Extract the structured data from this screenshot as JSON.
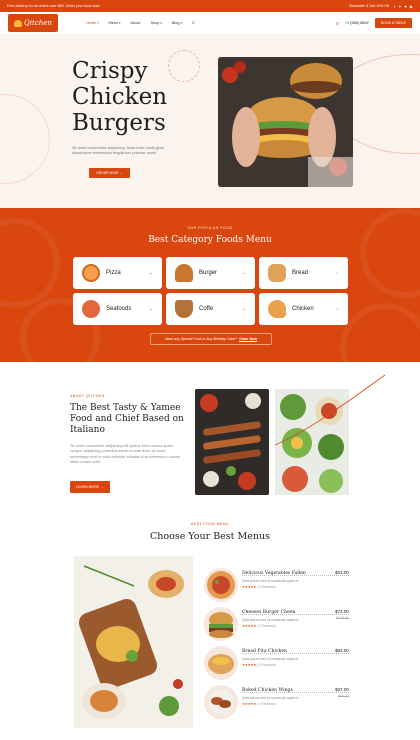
{
  "topbar": {
    "announcement": "Free delivery for all orders over $50. Order your food now!",
    "subscribe": "Subscribe & Get 10% Off",
    "social": [
      "f",
      "✦",
      "♥",
      "▶"
    ]
  },
  "header": {
    "logo_text": "Qitchen",
    "nav": [
      {
        "label": "Home",
        "active": true,
        "dropdown": true
      },
      {
        "label": "Menu",
        "active": false,
        "dropdown": true
      },
      {
        "label": "About",
        "active": false,
        "dropdown": false
      },
      {
        "label": "Shop",
        "active": false,
        "dropdown": true
      },
      {
        "label": "Blog",
        "active": false,
        "dropdown": true
      }
    ],
    "phone": "+1 (555) 5892",
    "book_label": "BOOK A TABLE"
  },
  "hero": {
    "title_lines": [
      "Crispy",
      "Chicken",
      "Burgers"
    ],
    "subtitle": "Sit amet consectetur adipiscing. Nulla iusto morbi gravi ullamcorper elementum feugiat nec pulvinar morbi",
    "button": "ORDER NOW →"
  },
  "categories": {
    "eyebrow": "OUR POPULAR FOOD",
    "heading": "Best Category Foods Menu",
    "items": [
      {
        "label": "Pizza",
        "icon": "pizza-icon",
        "color": "#f3a04a"
      },
      {
        "label": "Burger",
        "icon": "burger-icon",
        "color": "#c9772f"
      },
      {
        "label": "Bread",
        "icon": "bread-icon",
        "color": "#e0a35a"
      },
      {
        "label": "Seafoods",
        "icon": "octopus-icon",
        "color": "#e2673d"
      },
      {
        "label": "Coffe",
        "icon": "coffee-icon",
        "color": "#b5713a"
      },
      {
        "label": "Chicken",
        "icon": "chicken-icon",
        "color": "#e9a24a"
      }
    ],
    "note_text": "Need any Special Food or Any Birthday Cake? ",
    "note_link": "Order Now"
  },
  "about": {
    "eyebrow": "ABOUT QITCHEN",
    "title": "The Best Tasty & Yamee Food and Chief Based on Italiano",
    "text": "Sit amet consectetur adipiscing elit quisue Nam mauris quam congue adipiscing phasellus semin in ante dolor sit amet scelerisque erat in nulla molestie volutpat id at elementum mauris, etiam ornare dolor",
    "button": "LEARN MORE →"
  },
  "menus": {
    "eyebrow": "BEST FOOD MENU",
    "title": "Choose Your Best Menus",
    "items": [
      {
        "name": "Delicious Vegetables Fallen",
        "price": "$23.00",
        "old": "",
        "desc": "Quis ipsum sed et consecat coyat et",
        "reviews": "(1 Reviews)"
      },
      {
        "name": "Cheeses Burger Cheen",
        "price": "$73.00",
        "old": "$100.00",
        "desc": "Quis ipsum sed et consecat coyat et",
        "reviews": "(1 Reviews)"
      },
      {
        "name": "Bread Pita Chicken",
        "price": "$83.00",
        "old": "",
        "desc": "Quis ipsum sed et consecat coyat et",
        "reviews": "(1 Reviews)"
      },
      {
        "name": "Baked Chicken Wings",
        "price": "$37.00",
        "old": "$65.00",
        "desc": "Quis ipsum sed et consecat coyat et",
        "reviews": "(1 Reviews)"
      }
    ]
  }
}
